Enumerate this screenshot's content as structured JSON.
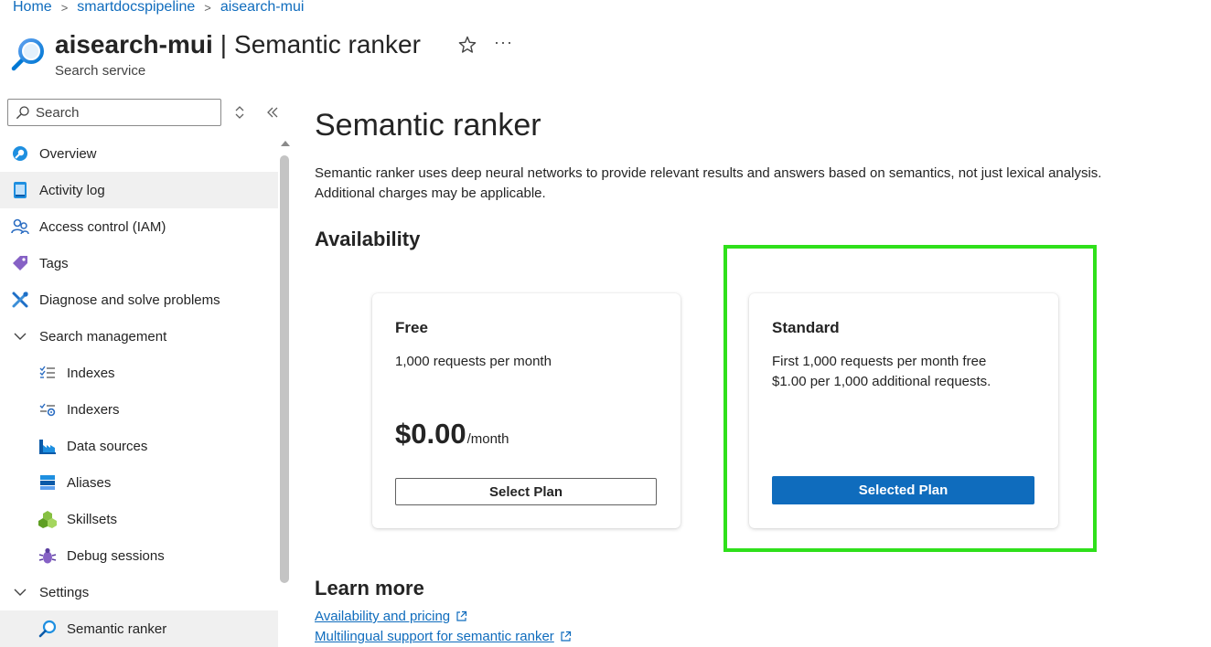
{
  "breadcrumb": {
    "items": [
      "Home",
      "smartdocspipeline",
      "aisearch-mui"
    ]
  },
  "header": {
    "resource_name": "aisearch-mui",
    "separator": "|",
    "page_name": "Semantic ranker",
    "subtitle": "Search service",
    "more": "···"
  },
  "sidebar": {
    "search_placeholder": "Search",
    "items": [
      {
        "label": "Overview",
        "icon": "overview-icon"
      },
      {
        "label": "Activity log",
        "icon": "activity-log-icon"
      },
      {
        "label": "Access control (IAM)",
        "icon": "people-icon"
      },
      {
        "label": "Tags",
        "icon": "tag-icon"
      },
      {
        "label": "Diagnose and solve problems",
        "icon": "wrench-icon"
      },
      {
        "label": "Search management",
        "icon": "chevron-down-icon"
      },
      {
        "label": "Indexes",
        "icon": "indexes-icon"
      },
      {
        "label": "Indexers",
        "icon": "indexers-icon"
      },
      {
        "label": "Data sources",
        "icon": "data-sources-icon"
      },
      {
        "label": "Aliases",
        "icon": "aliases-icon"
      },
      {
        "label": "Skillsets",
        "icon": "skillsets-icon"
      },
      {
        "label": "Debug sessions",
        "icon": "bug-icon"
      },
      {
        "label": "Settings",
        "icon": "chevron-down-icon"
      },
      {
        "label": "Semantic ranker",
        "icon": "search-icon"
      }
    ]
  },
  "main": {
    "title": "Semantic ranker",
    "description": "Semantic ranker uses deep neural networks to provide relevant results and answers based on semantics, not just lexical analysis. Additional charges may be applicable.",
    "availability_heading": "Availability",
    "plans": {
      "free": {
        "name": "Free",
        "line1": "1,000 requests per month",
        "price": "$0.00",
        "per": "/month",
        "button": "Select Plan"
      },
      "standard": {
        "name": "Standard",
        "line1": "First 1,000 requests per month free",
        "line2": "$1.00 per 1,000 additional requests.",
        "button": "Selected Plan"
      }
    },
    "learn_more_heading": "Learn more",
    "links": [
      "Availability and pricing",
      "Multilingual support for semantic ranker"
    ]
  },
  "colors": {
    "accent": "#0f6cbd",
    "highlight": "#2fe01b",
    "selected_row": "#f0f0f0"
  }
}
